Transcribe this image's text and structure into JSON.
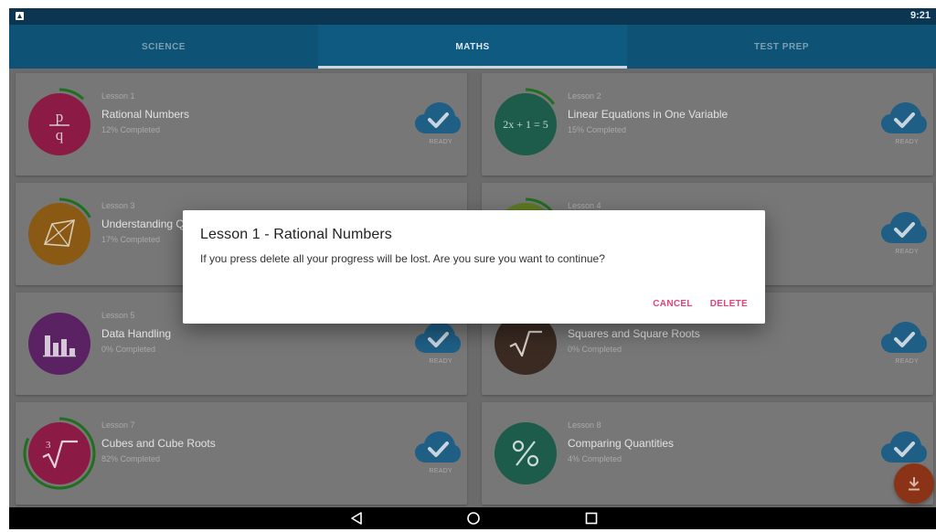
{
  "status_bar": {
    "time": "9:21",
    "notification_icon": "notification-a-icon"
  },
  "tabs": [
    {
      "label": "SCIENCE",
      "active": false
    },
    {
      "label": "MATHS",
      "active": true
    },
    {
      "label": "TEST PREP",
      "active": false
    }
  ],
  "lessons": [
    {
      "number": "Lesson 1",
      "title": "Rational Numbers",
      "progress": "12% Completed",
      "progress_fraction": 0.12,
      "status": "READY",
      "badge_color": "#8b1b44",
      "icon": "fraction-p-over-q-icon"
    },
    {
      "number": "Lesson 2",
      "title": "Linear Equations in One Variable",
      "progress": "15% Completed",
      "progress_fraction": 0.15,
      "status": "READY",
      "badge_color": "#1d5c4a",
      "icon": "equation-icon",
      "icon_text": "2x + 1 = 5"
    },
    {
      "number": "Lesson 3",
      "title": "Understanding Qu",
      "progress": "17% Completed",
      "progress_fraction": 0.17,
      "status": "",
      "badge_color": "#8a5a14",
      "icon": "quadrilateral-icon"
    },
    {
      "number": "Lesson 4",
      "title": "",
      "progress": "",
      "progress_fraction": 0.2,
      "status": "READY",
      "badge_color": "#5d7a23",
      "icon": "lesson-4-icon"
    },
    {
      "number": "Lesson 5",
      "title": "Data Handling",
      "progress": "0% Completed",
      "progress_fraction": 0,
      "status": "READY",
      "badge_color": "#5a2263",
      "icon": "bar-chart-icon"
    },
    {
      "number": "",
      "title": "Squares and Square Roots",
      "progress": "0% Completed",
      "progress_fraction": 0,
      "status": "READY",
      "badge_color": "#3a2a22",
      "icon": "square-root-icon"
    },
    {
      "number": "Lesson 7",
      "title": "Cubes and Cube Roots",
      "progress": "82% Completed",
      "progress_fraction": 0.82,
      "status": "READY",
      "badge_color": "#8b1b44",
      "icon": "cube-root-icon"
    },
    {
      "number": "Lesson 8",
      "title": "Comparing Quantities",
      "progress": "4% Completed",
      "progress_fraction": 0.04,
      "status": "RE",
      "badge_color": "#1d5c4a",
      "icon": "percent-icon"
    }
  ],
  "dialog": {
    "title": "Lesson 1 - Rational Numbers",
    "message": "If you press delete all your progress will be lost. Are you sure you want to continue?",
    "cancel_label": "CANCEL",
    "delete_label": "DELETE",
    "accent_color": "#e8407a"
  },
  "fab": {
    "icon": "download-icon",
    "color": "#8b3316"
  },
  "nav_bar": {
    "back_icon": "back-triangle-icon",
    "home_icon": "home-circle-icon",
    "recents_icon": "recents-square-icon"
  },
  "colors": {
    "ring_progress": "#1f6f1f",
    "cloud": "#1f5f86"
  }
}
